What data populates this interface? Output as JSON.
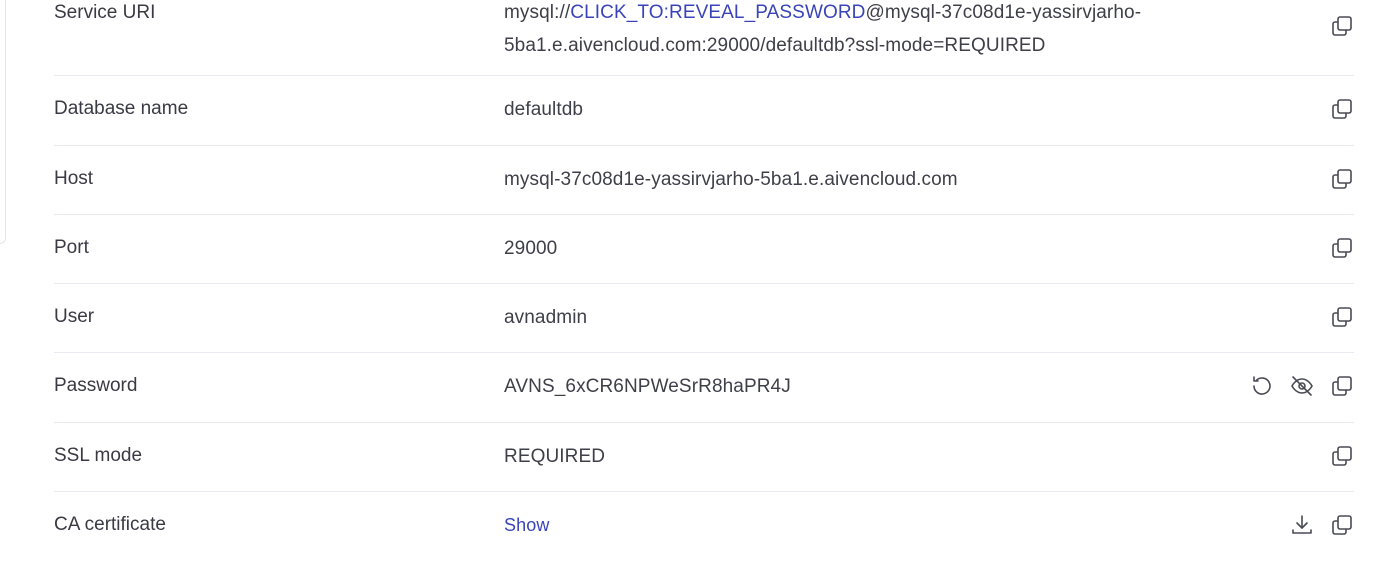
{
  "rows": {
    "service_uri": {
      "label": "Service URI",
      "prefix": "mysql://",
      "reveal_link": "CLICK_TO:REVEAL_PASSWORD",
      "suffix_line1": "@mysql-37c08d1e-yassirvjarho-",
      "line2": "5ba1.e.aivencloud.com:29000/defaultdb?ssl-mode=REQUIRED"
    },
    "database_name": {
      "label": "Database name",
      "value": "defaultdb"
    },
    "host": {
      "label": "Host",
      "value": "mysql-37c08d1e-yassirvjarho-5ba1.e.aivencloud.com"
    },
    "port": {
      "label": "Port",
      "value": "29000"
    },
    "user": {
      "label": "User",
      "value": "avnadmin"
    },
    "password": {
      "label": "Password",
      "value": "AVNS_6xCR6NPWeSrR8haPR4J"
    },
    "ssl_mode": {
      "label": "SSL mode",
      "value": "REQUIRED"
    },
    "ca_certificate": {
      "label": "CA certificate",
      "show_link": "Show"
    }
  },
  "icons": {
    "copy": "copy-icon",
    "reset": "reset-password-icon",
    "hide": "eye-off-icon",
    "download": "download-icon"
  },
  "colors": {
    "link": "#3a44b8",
    "text": "#3a3a44",
    "divider": "#e8e8ee"
  }
}
